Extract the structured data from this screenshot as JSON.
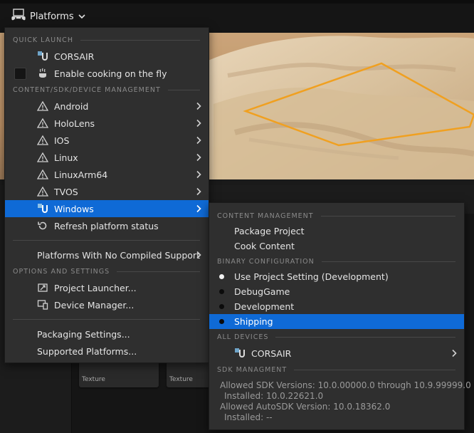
{
  "toolbar": {
    "platforms_label": "Platforms"
  },
  "background": {
    "tile_labels": [
      "Texture",
      "Texture"
    ]
  },
  "menu": {
    "quick_launch": {
      "header": "QUICK LAUNCH",
      "device": "CORSAIR",
      "cook_on_the_fly": "Enable cooking on the fly",
      "cook_on_the_fly_checked": false
    },
    "management": {
      "header": "CONTENT/SDK/DEVICE MANAGEMENT",
      "platforms": [
        "Android",
        "HoloLens",
        "IOS",
        "Linux",
        "LinuxArm64",
        "TVOS"
      ],
      "selected_platform": "Windows",
      "refresh": "Refresh platform status"
    },
    "no_compiled_support": "Platforms With No Compiled Support",
    "options": {
      "header": "OPTIONS AND SETTINGS",
      "project_launcher": "Project Launcher...",
      "device_manager": "Device Manager..."
    },
    "packaging_settings": "Packaging Settings...",
    "supported_platforms": "Supported Platforms..."
  },
  "submenu": {
    "content_header": "CONTENT MANAGEMENT",
    "package_project": "Package Project",
    "cook_content": "Cook Content",
    "binary_header": "BINARY CONFIGURATION",
    "configs": [
      {
        "label": "Use Project Setting (Development)",
        "selected": true
      },
      {
        "label": "DebugGame",
        "selected": false
      },
      {
        "label": "Development",
        "selected": false
      },
      {
        "label": "Shipping",
        "selected": false,
        "highlighted": true
      }
    ],
    "devices_header": "ALL DEVICES",
    "device": "CORSAIR",
    "sdk_header": "SDK MANAGMENT",
    "sdk_lines": [
      "Allowed SDK Versions: 10.0.00000.0 through 10.9.99999.0",
      "Installed: 10.0.22621.0",
      "Allowed AutoSDK Version: 10.0.18362.0",
      "Installed: --"
    ]
  },
  "colors": {
    "highlight": "#0f6ad6",
    "menu_bg": "#2f2f2f",
    "selection_outline": "#f0a020"
  },
  "icons": {
    "toolbar": "gamepad-icon",
    "windows_platform": "unreal-u-icon",
    "cooking": "steam-cup-icon",
    "warning": "warning-triangle-icon",
    "refresh": "refresh-icon",
    "launcher": "rocket-icon",
    "device_manager": "devices-icon"
  }
}
